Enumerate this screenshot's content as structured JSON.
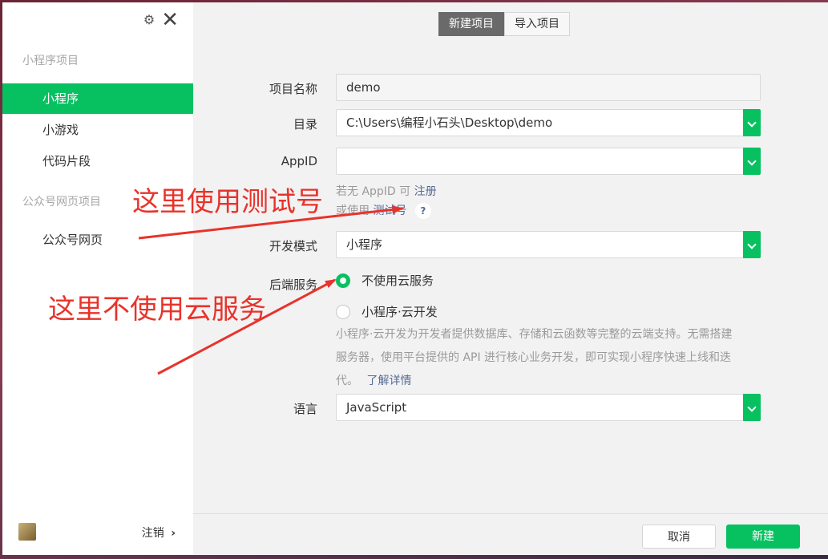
{
  "sidebar": {
    "section_miniprogram": "小程序项目",
    "items": [
      {
        "label": "小程序",
        "active": true
      },
      {
        "label": "小游戏",
        "active": false
      },
      {
        "label": "代码片段",
        "active": false
      }
    ],
    "section_official": "公众号网页项目",
    "official_items": [
      {
        "label": "公众号网页"
      }
    ],
    "logout": "注销",
    "logout_chevron": "›"
  },
  "tabs": [
    {
      "label": "新建项目",
      "active": true
    },
    {
      "label": "导入项目",
      "active": false
    }
  ],
  "form": {
    "project_name": {
      "label": "项目名称",
      "value": "demo"
    },
    "directory": {
      "label": "目录",
      "value": "C:\\Users\\编程小石头\\Desktop\\demo"
    },
    "appid": {
      "label": "AppID",
      "value": ""
    },
    "appid_hint1": "若无 AppID 可",
    "appid_hint1_link": "注册",
    "appid_hint2": "或使用",
    "appid_hint2_link": "测试号",
    "appid_help": "?",
    "dev_mode": {
      "label": "开发模式",
      "value": "小程序"
    },
    "backend": {
      "label": "后端服务",
      "options": [
        {
          "label": "不使用云服务",
          "selected": true
        },
        {
          "label": "小程序·云开发",
          "selected": false
        }
      ],
      "desc_line1": "小程序·云开发为开发者提供数据库、存储和云函数等完整的云端支持。无需搭建",
      "desc_line2": "服务器，使用平台提供的 API 进行核心业务开发，即可实现小程序快速上线和迭",
      "desc_line3": "代。",
      "desc_link": "了解详情"
    },
    "language": {
      "label": "语言",
      "value": "JavaScript"
    }
  },
  "footer": {
    "cancel": "取消",
    "create": "新建"
  },
  "annotations": {
    "use_test_account": "这里使用测试号",
    "no_cloud": "这里不使用云服务"
  },
  "colors": {
    "accent": "#07c160",
    "annotation": "#e8332a",
    "link": "#576b95"
  }
}
